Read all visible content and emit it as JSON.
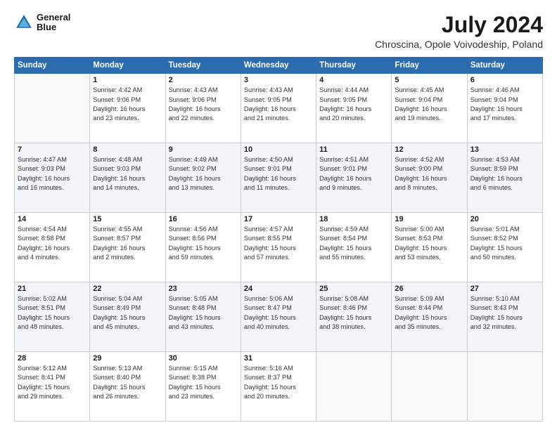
{
  "header": {
    "logo_line1": "General",
    "logo_line2": "Blue",
    "month": "July 2024",
    "location": "Chroscina, Opole Voivodeship, Poland"
  },
  "days_of_week": [
    "Sunday",
    "Monday",
    "Tuesday",
    "Wednesday",
    "Thursday",
    "Friday",
    "Saturday"
  ],
  "weeks": [
    [
      {
        "day": "",
        "info": ""
      },
      {
        "day": "1",
        "info": "Sunrise: 4:42 AM\nSunset: 9:06 PM\nDaylight: 16 hours\nand 23 minutes."
      },
      {
        "day": "2",
        "info": "Sunrise: 4:43 AM\nSunset: 9:06 PM\nDaylight: 16 hours\nand 22 minutes."
      },
      {
        "day": "3",
        "info": "Sunrise: 4:43 AM\nSunset: 9:05 PM\nDaylight: 16 hours\nand 21 minutes."
      },
      {
        "day": "4",
        "info": "Sunrise: 4:44 AM\nSunset: 9:05 PM\nDaylight: 16 hours\nand 20 minutes."
      },
      {
        "day": "5",
        "info": "Sunrise: 4:45 AM\nSunset: 9:04 PM\nDaylight: 16 hours\nand 19 minutes."
      },
      {
        "day": "6",
        "info": "Sunrise: 4:46 AM\nSunset: 9:04 PM\nDaylight: 16 hours\nand 17 minutes."
      }
    ],
    [
      {
        "day": "7",
        "info": "Sunrise: 4:47 AM\nSunset: 9:03 PM\nDaylight: 16 hours\nand 16 minutes."
      },
      {
        "day": "8",
        "info": "Sunrise: 4:48 AM\nSunset: 9:03 PM\nDaylight: 16 hours\nand 14 minutes."
      },
      {
        "day": "9",
        "info": "Sunrise: 4:49 AM\nSunset: 9:02 PM\nDaylight: 16 hours\nand 13 minutes."
      },
      {
        "day": "10",
        "info": "Sunrise: 4:50 AM\nSunset: 9:01 PM\nDaylight: 16 hours\nand 11 minutes."
      },
      {
        "day": "11",
        "info": "Sunrise: 4:51 AM\nSunset: 9:01 PM\nDaylight: 16 hours\nand 9 minutes."
      },
      {
        "day": "12",
        "info": "Sunrise: 4:52 AM\nSunset: 9:00 PM\nDaylight: 16 hours\nand 8 minutes."
      },
      {
        "day": "13",
        "info": "Sunrise: 4:53 AM\nSunset: 8:59 PM\nDaylight: 16 hours\nand 6 minutes."
      }
    ],
    [
      {
        "day": "14",
        "info": "Sunrise: 4:54 AM\nSunset: 8:58 PM\nDaylight: 16 hours\nand 4 minutes."
      },
      {
        "day": "15",
        "info": "Sunrise: 4:55 AM\nSunset: 8:57 PM\nDaylight: 16 hours\nand 2 minutes."
      },
      {
        "day": "16",
        "info": "Sunrise: 4:56 AM\nSunset: 8:56 PM\nDaylight: 15 hours\nand 59 minutes."
      },
      {
        "day": "17",
        "info": "Sunrise: 4:57 AM\nSunset: 8:55 PM\nDaylight: 15 hours\nand 57 minutes."
      },
      {
        "day": "18",
        "info": "Sunrise: 4:59 AM\nSunset: 8:54 PM\nDaylight: 15 hours\nand 55 minutes."
      },
      {
        "day": "19",
        "info": "Sunrise: 5:00 AM\nSunset: 8:53 PM\nDaylight: 15 hours\nand 53 minutes."
      },
      {
        "day": "20",
        "info": "Sunrise: 5:01 AM\nSunset: 8:52 PM\nDaylight: 15 hours\nand 50 minutes."
      }
    ],
    [
      {
        "day": "21",
        "info": "Sunrise: 5:02 AM\nSunset: 8:51 PM\nDaylight: 15 hours\nand 48 minutes."
      },
      {
        "day": "22",
        "info": "Sunrise: 5:04 AM\nSunset: 8:49 PM\nDaylight: 15 hours\nand 45 minutes."
      },
      {
        "day": "23",
        "info": "Sunrise: 5:05 AM\nSunset: 8:48 PM\nDaylight: 15 hours\nand 43 minutes."
      },
      {
        "day": "24",
        "info": "Sunrise: 5:06 AM\nSunset: 8:47 PM\nDaylight: 15 hours\nand 40 minutes."
      },
      {
        "day": "25",
        "info": "Sunrise: 5:08 AM\nSunset: 8:46 PM\nDaylight: 15 hours\nand 38 minutes."
      },
      {
        "day": "26",
        "info": "Sunrise: 5:09 AM\nSunset: 8:44 PM\nDaylight: 15 hours\nand 35 minutes."
      },
      {
        "day": "27",
        "info": "Sunrise: 5:10 AM\nSunset: 8:43 PM\nDaylight: 15 hours\nand 32 minutes."
      }
    ],
    [
      {
        "day": "28",
        "info": "Sunrise: 5:12 AM\nSunset: 8:41 PM\nDaylight: 15 hours\nand 29 minutes."
      },
      {
        "day": "29",
        "info": "Sunrise: 5:13 AM\nSunset: 8:40 PM\nDaylight: 15 hours\nand 26 minutes."
      },
      {
        "day": "30",
        "info": "Sunrise: 5:15 AM\nSunset: 8:38 PM\nDaylight: 15 hours\nand 23 minutes."
      },
      {
        "day": "31",
        "info": "Sunrise: 5:16 AM\nSunset: 8:37 PM\nDaylight: 15 hours\nand 20 minutes."
      },
      {
        "day": "",
        "info": ""
      },
      {
        "day": "",
        "info": ""
      },
      {
        "day": "",
        "info": ""
      }
    ]
  ]
}
